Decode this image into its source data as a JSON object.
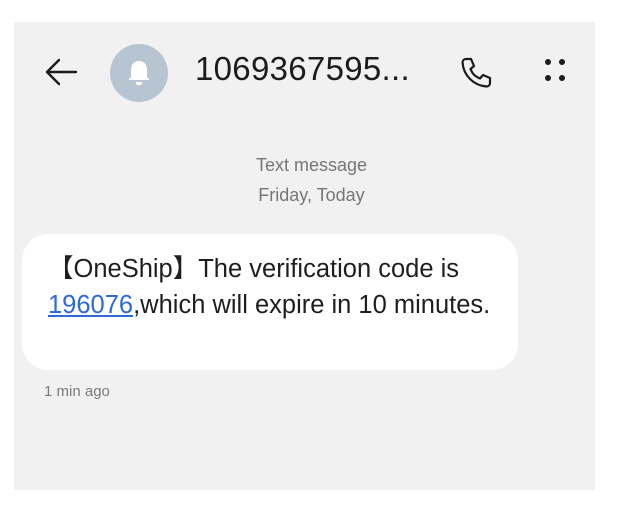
{
  "header": {
    "contact": "1069367595...",
    "back_icon": "arrow-left-icon",
    "avatar_icon": "bell-avatar-icon",
    "call_icon": "phone-icon",
    "more_icon": "more-dots-icon"
  },
  "thread": {
    "channel": "Text message",
    "date": "Friday, Today"
  },
  "message": {
    "text_before": "【OneShip】The verification code is ",
    "code": "196076",
    "text_after": ",which will expire in 10 minutes.",
    "time": "1 min ago"
  },
  "colors": {
    "background": "#f1f1f1",
    "bubble": "#ffffff",
    "link": "#2d6ad8",
    "avatar": "#b7c4d2"
  }
}
